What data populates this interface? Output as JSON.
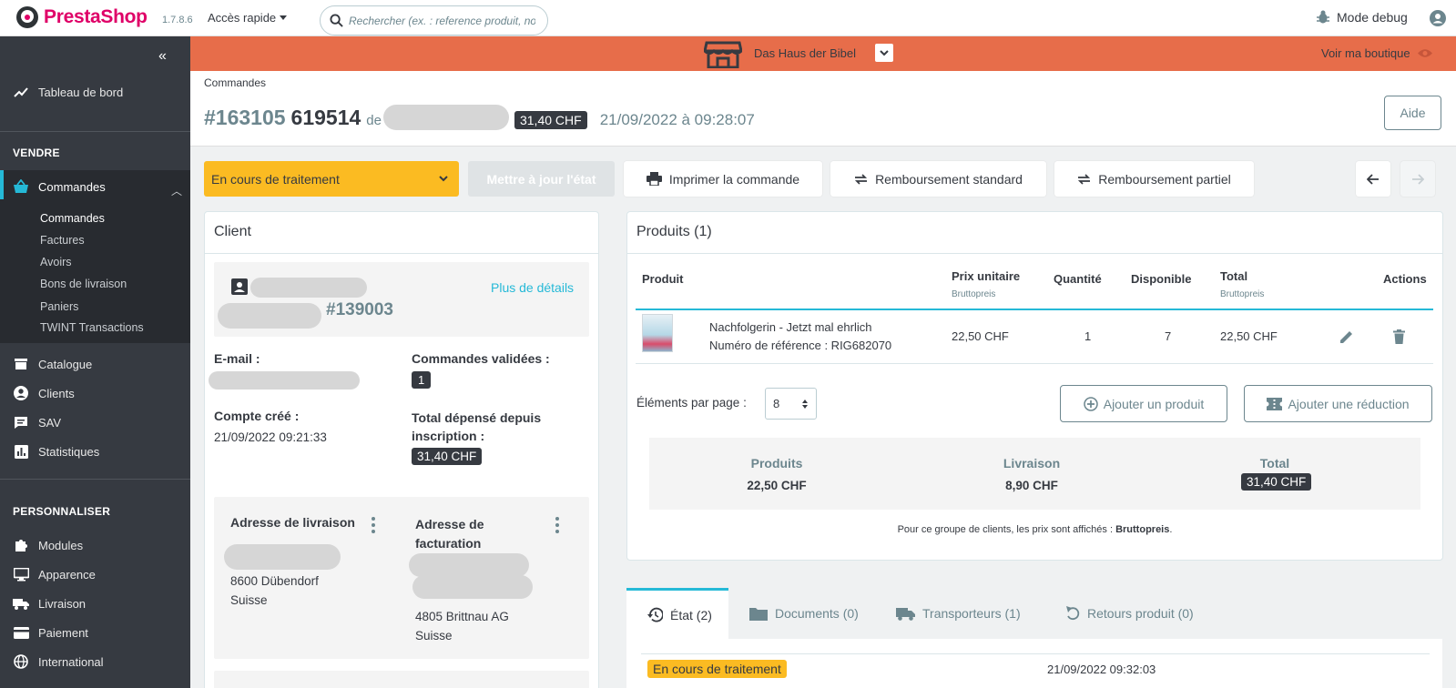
{
  "header": {
    "brand": "PrestaShop",
    "version": "1.7.8.6",
    "quick_access": "Accès rapide",
    "search_placeholder": "Rechercher (ex. : reference produit, no",
    "debug_mode": "Mode debug"
  },
  "sidebar": {
    "dashboard": "Tableau de bord",
    "section_sell": "VENDRE",
    "orders": "Commandes",
    "sub_items": [
      "Commandes",
      "Factures",
      "Avoirs",
      "Bons de livraison",
      "Paniers",
      "TWINT Transactions"
    ],
    "catalog": "Catalogue",
    "customers": "Clients",
    "sav": "SAV",
    "stats": "Statistiques",
    "section_custom": "PERSONNALISER",
    "modules": "Modules",
    "appearance": "Apparence",
    "shipping": "Livraison",
    "payment": "Paiement",
    "international": "International"
  },
  "shopbar": {
    "shop_name": "Das Haus der Bibel",
    "view_shop": "Voir ma boutique",
    "color": "#e76d4a"
  },
  "page": {
    "breadcrumb": "Commandes",
    "order_id": "#163105",
    "order_reference": "619514",
    "from": "de",
    "total_badge": "31,40 CHF",
    "order_date": "21/09/2022 à 09:28:07",
    "help": "Aide"
  },
  "toolbar": {
    "status": "En cours de traitement",
    "update_status": "Mettre à jour l'état",
    "print_order": "Imprimer la commande",
    "standard_refund": "Remboursement standard",
    "partial_refund": "Remboursement partiel"
  },
  "customer": {
    "title": "Client",
    "more_details": "Plus de détails",
    "customer_id": "#139003",
    "email_label": "E-mail :",
    "validated_orders_label": "Commandes validées :",
    "validated_orders": "1",
    "account_created_label": "Compte créé :",
    "account_created": "21/09/2022 09:21:33",
    "total_spent_label": "Total dépensé depuis inscription :",
    "total_spent": "31,40 CHF",
    "shipping_address_label": "Adresse de livraison",
    "shipping_city": "8600 Dübendorf",
    "shipping_country": "Suisse",
    "billing_address_label": "Adresse de facturation",
    "billing_city": "4805 Brittnau AG",
    "billing_country": "Suisse"
  },
  "products": {
    "title": "Produits (1)",
    "columns": {
      "product": "Produit",
      "unit_price": "Prix unitaire",
      "unit_price_sub": "Bruttopreis",
      "quantity": "Quantité",
      "available": "Disponible",
      "total": "Total",
      "total_sub": "Bruttopreis",
      "actions": "Actions"
    },
    "rows": [
      {
        "name": "Nachfolgerin - Jetzt mal ehrlich",
        "reference": "Numéro de référence : RIG682070",
        "unit_price": "22,50 CHF",
        "quantity": "1",
        "available": "7",
        "total": "22,50 CHF"
      }
    ],
    "per_page_label": "Éléments par page :",
    "per_page": "8",
    "add_product": "Ajouter un produit",
    "add_discount": "Ajouter une réduction",
    "summary": {
      "products_label": "Produits",
      "products_value": "22,50 CHF",
      "shipping_label": "Livraison",
      "shipping_value": "8,90 CHF",
      "total_label": "Total",
      "total_value": "31,40 CHF"
    },
    "price_note_prefix": "Pour ce groupe de clients, les prix sont affichés :",
    "price_note_value": "Bruttopreis",
    "price_note_suffix": "."
  },
  "tabs": {
    "items": [
      "État (2)",
      "Documents (0)",
      "Transporteurs (1)",
      "Retours produit (0)"
    ],
    "state_badge": "En cours de traitement",
    "state_date": "21/09/2022 09:32:03"
  },
  "colors": {
    "accent": "#25b9d7",
    "brand": "#df0067",
    "status": "#fbbb22",
    "sidebar": "#363a41"
  }
}
